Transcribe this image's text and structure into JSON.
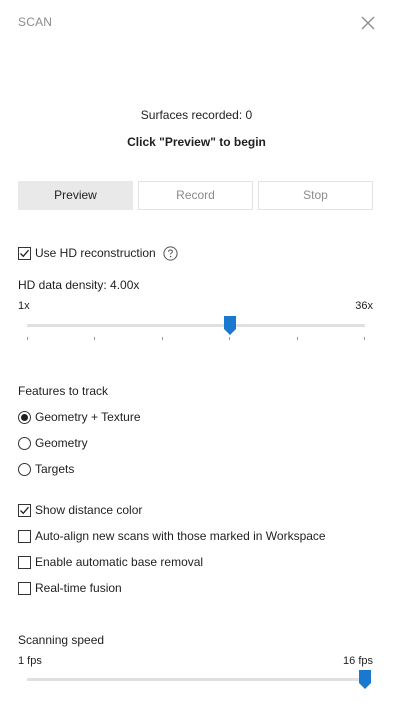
{
  "panel": {
    "title": "SCAN",
    "close_icon": "close-icon"
  },
  "status": {
    "surfaces": "Surfaces recorded: 0",
    "hint": "Click \"Preview\" to begin"
  },
  "buttons": {
    "preview": "Preview",
    "record": "Record",
    "stop": "Stop",
    "active": "Preview"
  },
  "hd": {
    "checkbox_label": "Use HD reconstruction",
    "checked": true,
    "help_icon": "help-circle-icon",
    "density_label": "HD data density: 4.00x",
    "min_label": "1x",
    "max_label": "36x",
    "value_fraction": 0.6,
    "tick_count": 6
  },
  "features": {
    "title": "Features to track",
    "options": [
      "Geometry + Texture",
      "Geometry",
      "Targets"
    ],
    "selected": "Geometry + Texture"
  },
  "options": {
    "show_distance_color": {
      "label": "Show distance color",
      "checked": true
    },
    "auto_align": {
      "label": "Auto-align new scans with those marked in Workspace",
      "checked": false
    },
    "base_removal": {
      "label": "Enable automatic base removal",
      "checked": false
    },
    "realtime_fusion": {
      "label": "Real-time fusion",
      "checked": false
    }
  },
  "speed": {
    "label": "Scanning speed",
    "min_label": "1 fps",
    "max_label": "16 fps",
    "value_fraction": 1.0
  },
  "colors": {
    "accent": "#1b78d0",
    "check": "#1f1f1f"
  }
}
